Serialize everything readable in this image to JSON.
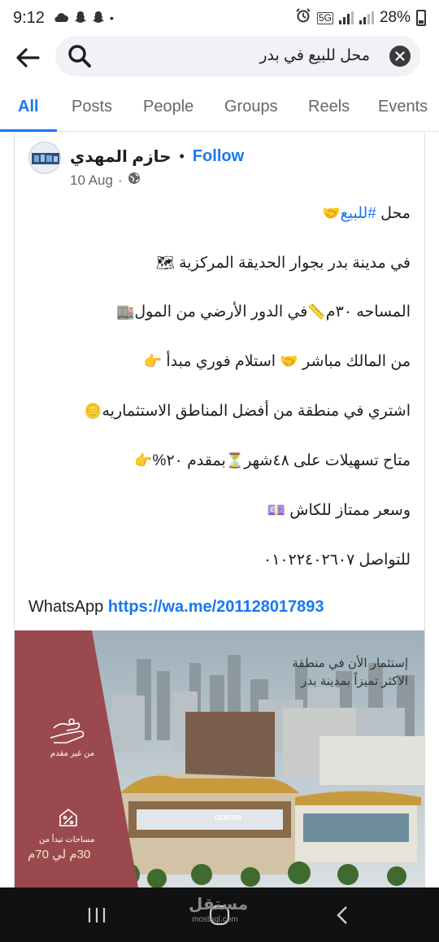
{
  "status_bar": {
    "time": "9:12",
    "dot": "•",
    "network": "5G",
    "battery": "28%"
  },
  "search": {
    "query": "محل للبيع في بدر"
  },
  "tabs": [
    {
      "label": "All",
      "active": true
    },
    {
      "label": "Posts"
    },
    {
      "label": "People"
    },
    {
      "label": "Groups"
    },
    {
      "label": "Reels"
    },
    {
      "label": "Events"
    }
  ],
  "post": {
    "author": "حازم المهدي",
    "separator": "•",
    "follow_label": "Follow",
    "date": "10 Aug",
    "meta_separator": "·",
    "body": {
      "line1_prefix": "محل ",
      "line1_hashtag": "#للبيع",
      "line1_emoji": "🤝",
      "line2": "في مدينة بدر بجوار الحديقة المركزية",
      "line2_emoji": "🗺",
      "line3": "المساحه ٣٠م",
      "line3_mid_emoji": "📏",
      "line3_rest": "في الدور الأرضي من المول",
      "line3_emoji": "🏬",
      "line4": "من المالك مباشر",
      "line4_emoji1": "🤝",
      "line4_rest": " استلام فوري مبدأ ",
      "line4_emoji2": "👉",
      "line5": "اشتري في منطقة من أفضل المناطق الاستثماريه",
      "line5_emoji": "🪙",
      "line6": "متاح تسهيلات على ٤٨شهر",
      "line6_emoji1": "⏳",
      "line6_rest": "بمقدم ٢٠%",
      "line6_emoji2": "👉",
      "line7": "وسعر ممتاز للكاش",
      "line7_emoji": "💷",
      "line8": "للتواصل ٠١٠٢٢٤٠٢٦٠٧"
    },
    "whatsapp_label": "WhatsApp",
    "whatsapp_link": "https://wa.me/201128017893",
    "image": {
      "headline_line1": "إستثمار الأن في منطقة",
      "headline_line2": "الاكثر تميزاً بمدينة بدر",
      "panel_label1": "من غير مقدم",
      "panel_label2": "مساحات تبدأ من",
      "area_text": "30م لي 70م",
      "sign_center": "CENTER"
    }
  },
  "nav": {
    "watermark": "مستقل",
    "watermark_sub": "mostaql.com"
  },
  "colors": {
    "accent": "#1877f2",
    "panel": "#9a4a4e",
    "nav_bg": "#111111"
  }
}
